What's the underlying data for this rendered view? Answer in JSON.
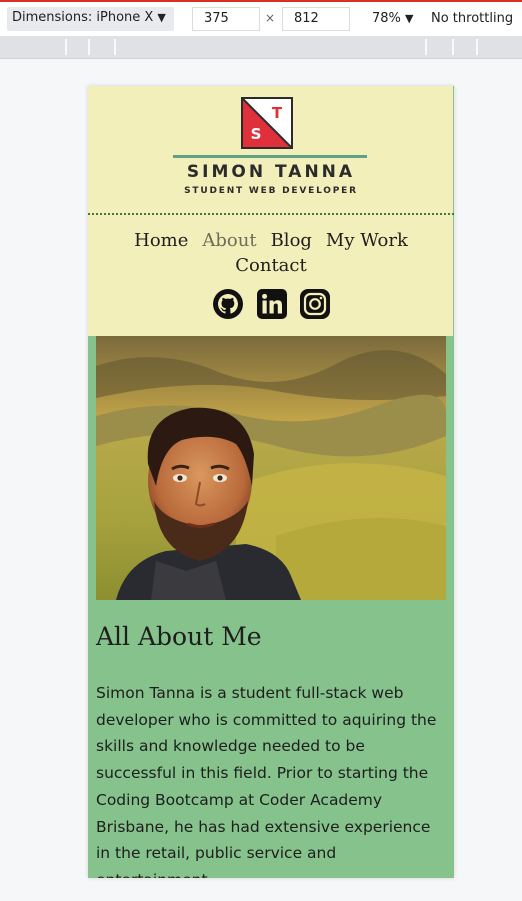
{
  "devtools": {
    "device_label": "Dimensions: iPhone X",
    "width": "375",
    "times": "×",
    "height": "812",
    "zoom": "78%",
    "throttling": "No throttling"
  },
  "header": {
    "logo_letters": [
      "S",
      "T"
    ],
    "brand_name": "SIMON TANNA",
    "tagline": "STUDENT WEB DEVELOPER"
  },
  "nav": {
    "items": [
      "Home",
      "About",
      "Blog",
      "My Work",
      "Contact"
    ],
    "active": "About"
  },
  "socials": [
    "github-icon",
    "linkedin-icon",
    "instagram-icon"
  ],
  "colors": {
    "header_bg": "#f3efba",
    "page_bg": "#86c28c",
    "logo_red": "#e0303c",
    "accent_line": "#5fa186"
  },
  "about": {
    "title": "All About Me",
    "text": "Simon Tanna is a student full-stack web developer who is committed to aquiring the skills and knowledge needed to be successful in this field. Prior to starting the Coding Bootcamp at Coder Academy Brisbane, he has had extensive experience in the retail, public service and entertainment"
  }
}
